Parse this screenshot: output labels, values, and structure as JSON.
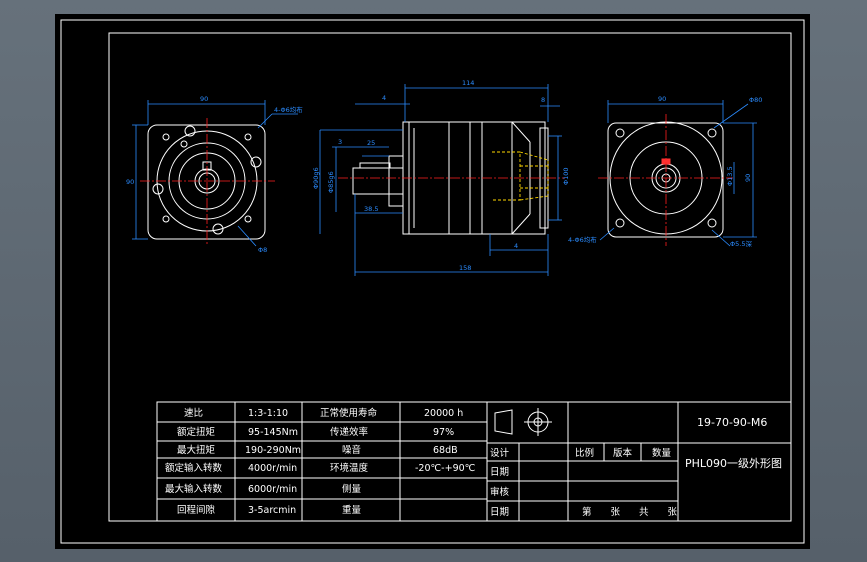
{
  "drawing": {
    "code": "19-70-90-M6",
    "name": "PHL090一级外形图"
  },
  "dimensions": {
    "left_width": "90",
    "left_holes": "4-Φ6均布",
    "left_height": "90",
    "left_dia": "Φ8",
    "mid_top_4": "4",
    "mid_top_114": "114",
    "mid_top_8": "8",
    "mid_3": "3",
    "mid_25": "25",
    "mid_dia_a": "Φ90g6",
    "mid_dia_b": "Φ85g6",
    "mid_dia_c": "Φ100",
    "mid_38": "38.5",
    "mid_4b": "4",
    "mid_total": "158",
    "right_width": "90",
    "right_dia_top": "Φ80",
    "right_pcd": "Φ13.5",
    "right_height": "90",
    "right_holes": "4-Φ6均布",
    "right_bottom": "Φ5.5深"
  },
  "specs": {
    "rows": [
      {
        "l1": "速比",
        "v1": "1:3-1:10",
        "l2": "正常使用寿命",
        "v2": "20000 h"
      },
      {
        "l1": "额定扭矩",
        "v1": "95-145Nm",
        "l2": "传递效率",
        "v2": "97%"
      },
      {
        "l1": "最大扭矩",
        "v1": "190-290Nm",
        "l2": "噪音",
        "v2": "68dB"
      },
      {
        "l1": "额定输入转数",
        "v1": "4000r/min",
        "l2": "环境温度",
        "v2": "-20℃-+90℃"
      },
      {
        "l1": "最大输入转数",
        "v1": "6000r/min",
        "l2": "侧量",
        "v2": ""
      },
      {
        "l1": "回程间隙",
        "v1": "3-5arcmin",
        "l2": "重量",
        "v2": ""
      }
    ]
  },
  "title_block": {
    "design": "设计",
    "date1": "日期",
    "review": "审核",
    "date2": "日期",
    "scale": "比例",
    "edition": "版本",
    "quantity": "数量",
    "sheets": "第  张  共  张"
  }
}
